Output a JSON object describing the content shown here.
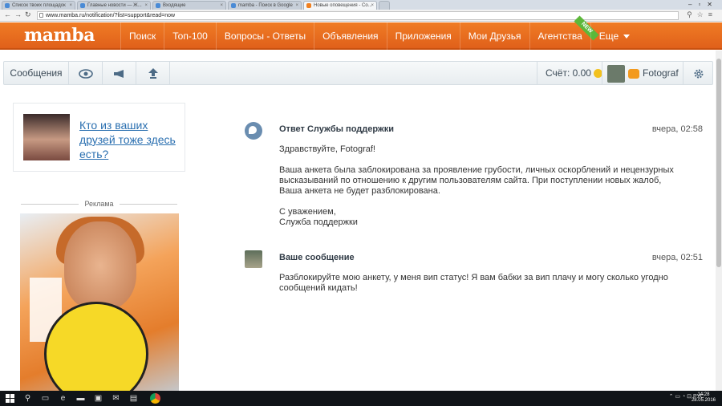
{
  "browser": {
    "tabs": [
      {
        "label": "Список твоих площадок"
      },
      {
        "label": "Главные новости — Ж..."
      },
      {
        "label": "Входящие"
      },
      {
        "label": "mamba - Поиск в Google"
      },
      {
        "label": "Новые оповещения - Co..."
      }
    ],
    "url": "www.mamba.ru/notification/?list=support&read=now"
  },
  "header": {
    "logo": "mamba",
    "menu": [
      "Поиск",
      "Топ-100",
      "Вопросы - Ответы",
      "Объявления",
      "Приложения",
      "Мои Друзья",
      "Агентства",
      "Еще"
    ],
    "new_badge": "NEW"
  },
  "subnav": {
    "messages_label": "Сообщения",
    "balance": "Счёт: 0.00",
    "username": "Fotograf"
  },
  "sidebar": {
    "friends_prompt": "Кто из ваших друзей тоже здесь есть?",
    "ad_label": "Реклама"
  },
  "messages": [
    {
      "sender": "Ответ Службы поддержки",
      "time": "вчера, 02:58",
      "paragraphs": [
        "Здравствуйте, Fotograf!",
        "Ваша анкета была заблокирована за проявление грубости, личных оскорблений и нецензурных высказываний по отношению к другим пользователям сайта. При поступлении новых жалоб, Ваша анкета не будет разблокирована.",
        "С уважением,\nСлужба поддержки"
      ]
    },
    {
      "sender": "Ваше сообщение",
      "time": "вчера, 02:51",
      "paragraphs": [
        "Разблокируйте мою анкету, у меня вип статус! Я вам бабки за вип плачу и могу сколько угодно сообщений кидать!"
      ]
    }
  ],
  "taskbar": {
    "language": "РУС",
    "time": "14:28",
    "date": "28.05.2016"
  }
}
